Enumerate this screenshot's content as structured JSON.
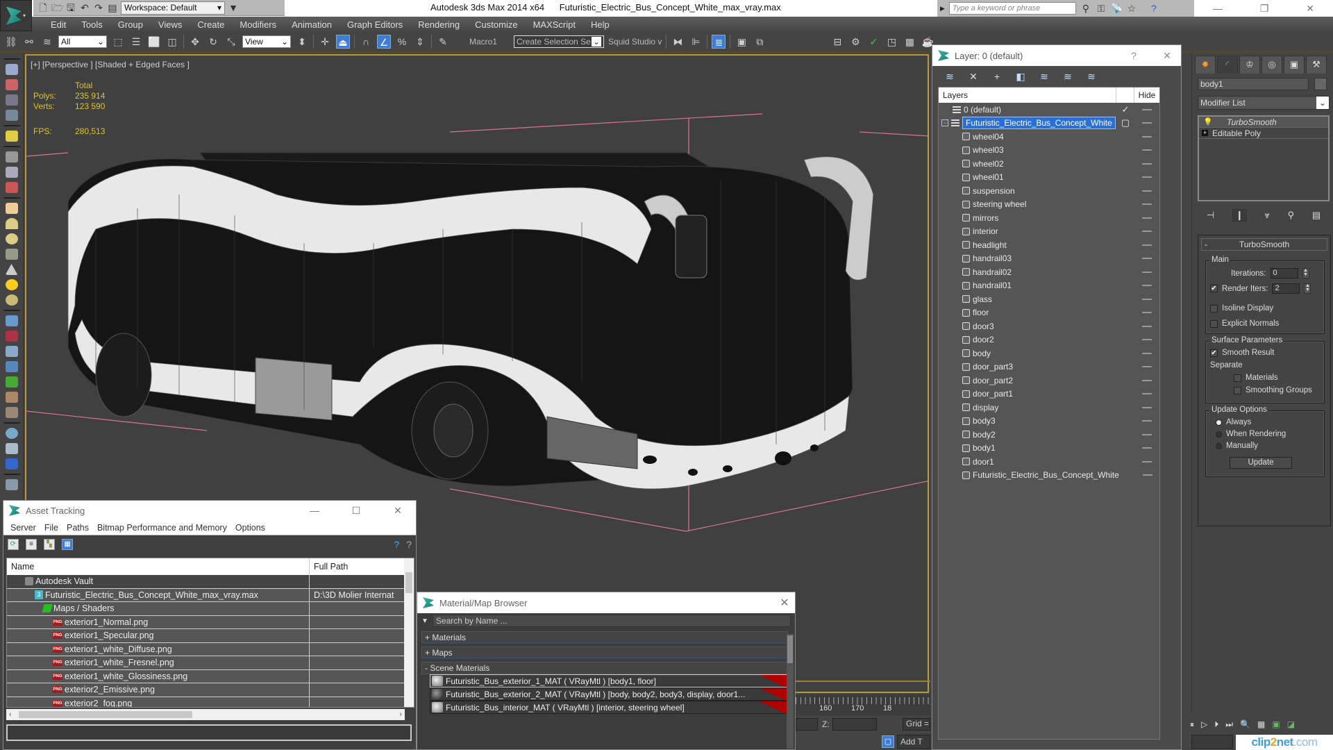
{
  "app": {
    "title": "Autodesk 3ds Max  2014 x64",
    "file": "Futuristic_Electric_Bus_Concept_White_max_vray.max",
    "workspace": "Workspace: Default",
    "search_placeholder": "Type a keyword or phrase"
  },
  "menu": [
    "Edit",
    "Tools",
    "Group",
    "Views",
    "Create",
    "Modifiers",
    "Animation",
    "Graph Editors",
    "Rendering",
    "Customize",
    "MAXScript",
    "Help"
  ],
  "toolbar": {
    "selection_filter": "All",
    "ref_coord": "View",
    "macro_label": "Macro1",
    "named_selection": "Create Selection Se",
    "squid_label": "Squid Studio v"
  },
  "viewport": {
    "label": "[+] [Perspective ] [Shaded + Edged Faces ]",
    "stats_header": "Total",
    "polys_label": "Polys:",
    "polys_value": "235 914",
    "verts_label": "Verts:",
    "verts_value": "123 590",
    "fps_label": "FPS:",
    "fps_value": "280,513",
    "accent_color": "#b59a35",
    "stats_color": "#e0c22a"
  },
  "layer_dialog": {
    "title": "Layer: 0 (default)",
    "help": "?",
    "col_layers": "Layers",
    "col_hide": "Hide",
    "default_layer": "0 (default)",
    "active_layer": "Futuristic_Electric_Bus_Concept_White",
    "objects": [
      "wheel04",
      "wheel03",
      "wheel02",
      "wheel01",
      "suspension",
      "steering wheel",
      "mirrors",
      "interior",
      "headlight",
      "handrail03",
      "handrail02",
      "handrail01",
      "glass",
      "floor",
      "door3",
      "door2",
      "body",
      "door_part3",
      "door_part2",
      "door_part1",
      "display",
      "body3",
      "body2",
      "body1",
      "door1",
      "Futuristic_Electric_Bus_Concept_White"
    ]
  },
  "command_panel": {
    "object_name": "body1",
    "modifier_list": "Modifier List",
    "stack": [
      "TurboSmooth",
      "Editable Poly"
    ],
    "turbosmooth": {
      "title": "TurboSmooth",
      "main_label": "Main",
      "iterations_label": "Iterations:",
      "iterations_value": "0",
      "render_iters_label": "Render Iters:",
      "render_iters_value": "2",
      "render_iters_checked": true,
      "isoline_label": "Isoline Display",
      "isoline_checked": false,
      "explicit_normals_label": "Explicit Normals",
      "explicit_normals_checked": false,
      "surface_label": "Surface Parameters",
      "smooth_result_label": "Smooth Result",
      "smooth_result_checked": true,
      "separate_label": "Separate",
      "materials_label": "Materials",
      "smoothing_groups_label": "Smoothing Groups",
      "update_options_label": "Update Options",
      "always_label": "Always",
      "when_rendering_label": "When Rendering",
      "manually_label": "Manually",
      "update_mode": "Always",
      "update_button": "Update"
    }
  },
  "asset_tracking": {
    "title": "Asset Tracking",
    "menu": [
      "Server",
      "File",
      "Paths",
      "Bitmap Performance and Memory",
      "Options"
    ],
    "col_name": "Name",
    "col_path": "Full Path",
    "rows": [
      {
        "name": "Autodesk Vault",
        "path": "",
        "icon": "vault"
      },
      {
        "name": "Futuristic_Electric_Bus_Concept_White_max_vray.max",
        "path": "D:\\3D Molier Internat",
        "icon": "max"
      },
      {
        "name": "Maps / Shaders",
        "path": "",
        "icon": "maps"
      },
      {
        "name": "exterior1_Normal.png",
        "path": "",
        "icon": "png"
      },
      {
        "name": "exterior1_Specular.png",
        "path": "",
        "icon": "png"
      },
      {
        "name": "exterior1_white_Diffuse.png",
        "path": "",
        "icon": "png"
      },
      {
        "name": "exterior1_white_Fresnel.png",
        "path": "",
        "icon": "png"
      },
      {
        "name": "exterior1_white_Glossiness.png",
        "path": "",
        "icon": "png"
      },
      {
        "name": "exterior2_Emissive.png",
        "path": "",
        "icon": "png"
      },
      {
        "name": "exterior2_fog.png",
        "path": "",
        "icon": "png"
      }
    ]
  },
  "material_browser": {
    "title": "Material/Map Browser",
    "search_placeholder": "Search by Name ...",
    "groups": [
      "+ Materials",
      "+ Maps",
      "- Scene Materials"
    ],
    "materials": [
      "Futuristic_Bus_exterior_1_MAT  ( VRayMtl )  [body1, floor]",
      "Futuristic_Bus_exterior_2_MAT  ( VRayMtl ) [body, body2, body3, display, door1...",
      "Futuristic_Bus_interior_MAT  ( VRayMtl )  [interior, steering wheel]"
    ]
  },
  "timeline": {
    "ticks": [
      "160",
      "170",
      "18"
    ],
    "z_label": "Z:",
    "grid_label": "Grid =",
    "add_time_tag": "Add T"
  },
  "watermark": {
    "a": "clip",
    "b": "2",
    "c": "net",
    "d": ".com"
  }
}
